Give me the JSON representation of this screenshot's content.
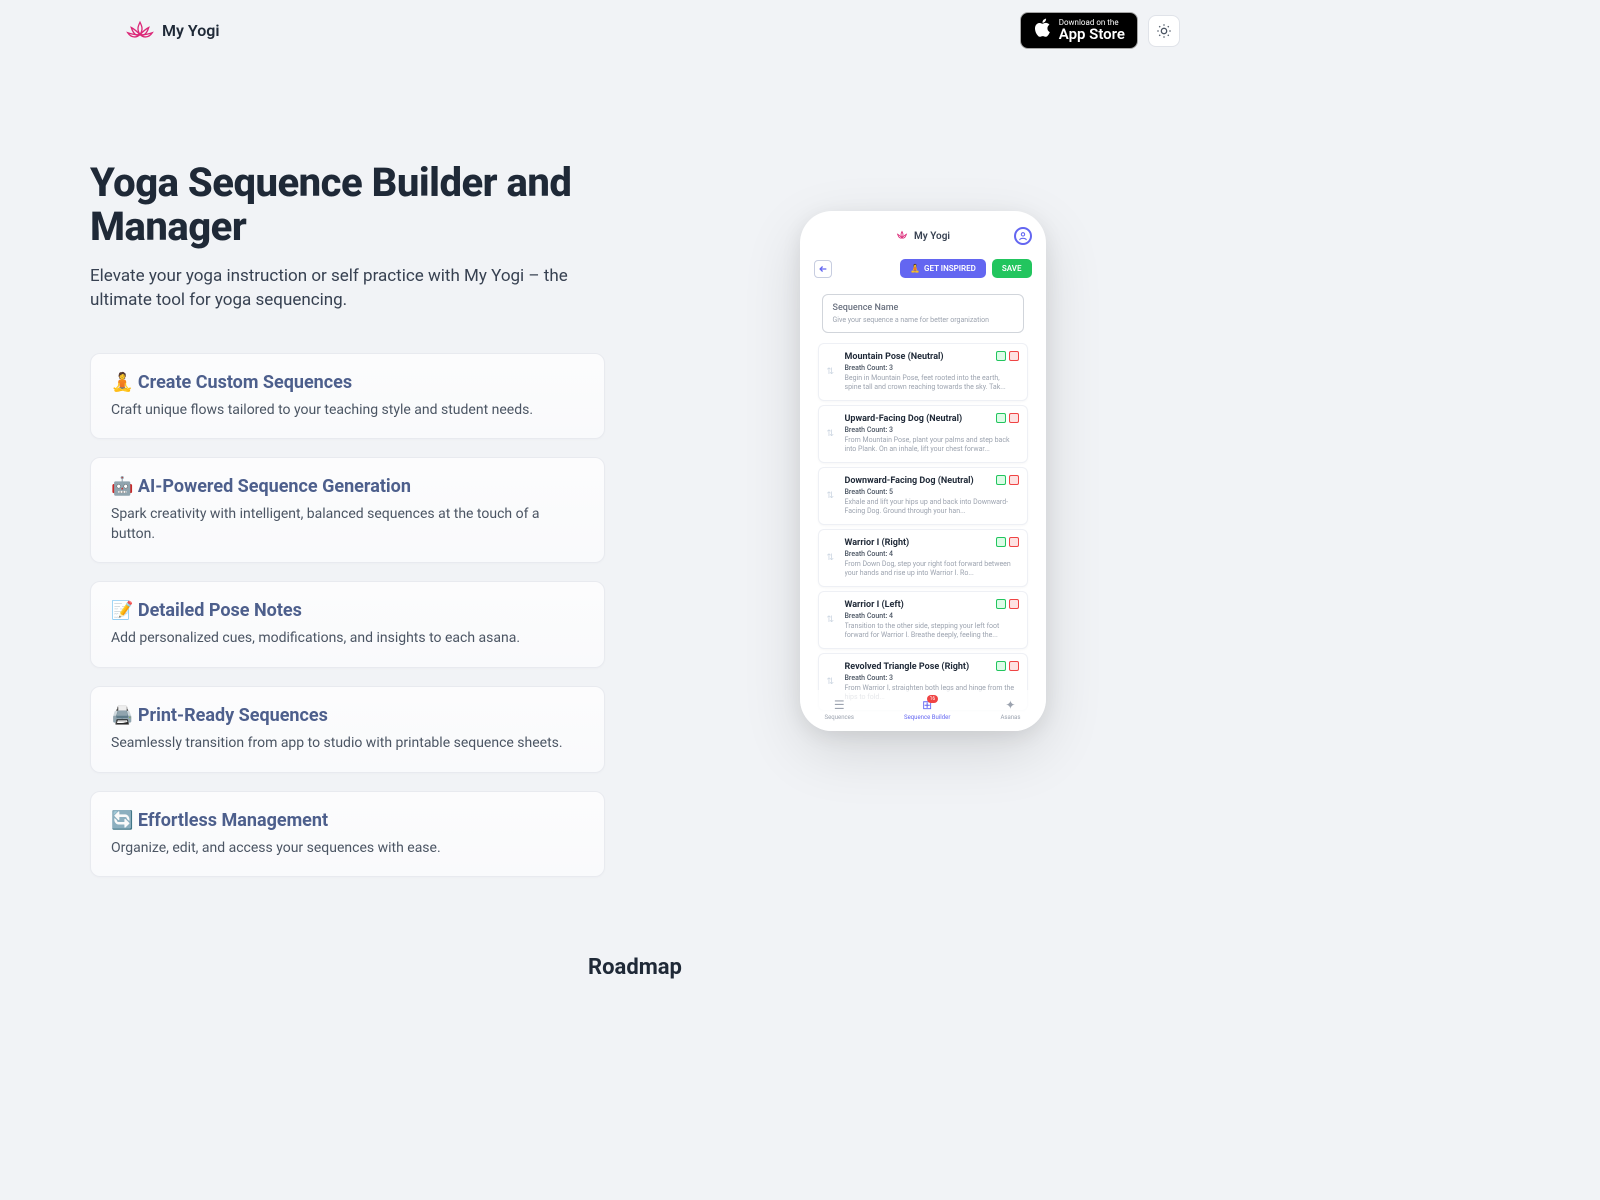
{
  "header": {
    "brand": "My Yogi",
    "appStore": {
      "small": "Download on the",
      "large": "App Store"
    }
  },
  "hero": {
    "title": "Yoga Sequence Builder and Manager",
    "subtitle": "Elevate your yoga instruction or self practice with My Yogi – the ultimate tool for yoga sequencing."
  },
  "features": [
    {
      "title": "🧘 Create Custom Sequences",
      "desc": "Craft unique flows tailored to your teaching style and student needs."
    },
    {
      "title": "🤖 AI-Powered Sequence Generation",
      "desc": "Spark creativity with intelligent, balanced sequences at the touch of a button."
    },
    {
      "title": "📝 Detailed Pose Notes",
      "desc": "Add personalized cues, modifications, and insights to each asana."
    },
    {
      "title": "🖨️ Print-Ready Sequences",
      "desc": "Seamlessly transition from app to studio with printable sequence sheets."
    },
    {
      "title": "🔄 Effortless Management",
      "desc": "Organize, edit, and access your sequences with ease."
    }
  ],
  "phone": {
    "brand": "My Yogi",
    "getInspired": "GET INSPIRED",
    "save": "SAVE",
    "inputLabel": "Sequence Name",
    "inputPlaceholder": "Give your sequence a name for better organization",
    "poses": [
      {
        "name": "Mountain Pose (Neutral)",
        "breath": "Breath Count: 3",
        "desc": "Begin in Mountain Pose, feet rooted into the earth, spine tall and crown reaching towards the sky. Tak..."
      },
      {
        "name": "Upward-Facing Dog (Neutral)",
        "breath": "Breath Count: 3",
        "desc": "From Mountain Pose, plant your palms and step back into Plank. On an inhale, lift your chest forwar..."
      },
      {
        "name": "Downward-Facing Dog (Neutral)",
        "breath": "Breath Count: 5",
        "desc": "Exhale and lift your hips up and back into Downward-Facing Dog. Ground through your han..."
      },
      {
        "name": "Warrior I (Right)",
        "breath": "Breath Count: 4",
        "desc": "From Down Dog, step your right foot forward between your hands and rise up into Warrior I. Ro..."
      },
      {
        "name": "Warrior I (Left)",
        "breath": "Breath Count: 4",
        "desc": "Transition to the other side, stepping your left foot forward for Warrior I. Breathe deeply, feeling the..."
      },
      {
        "name": "Revolved Triangle Pose (Right)",
        "breath": "Breath Count: 3",
        "desc": "From Warrior I, straighten both legs and hinge from the hips to fold..."
      }
    ],
    "nav": {
      "sequences": "Sequences",
      "builder": "Sequence Builder",
      "asanas": "Asanas",
      "badge": "16"
    }
  },
  "roadmap": {
    "title": "Roadmap"
  }
}
